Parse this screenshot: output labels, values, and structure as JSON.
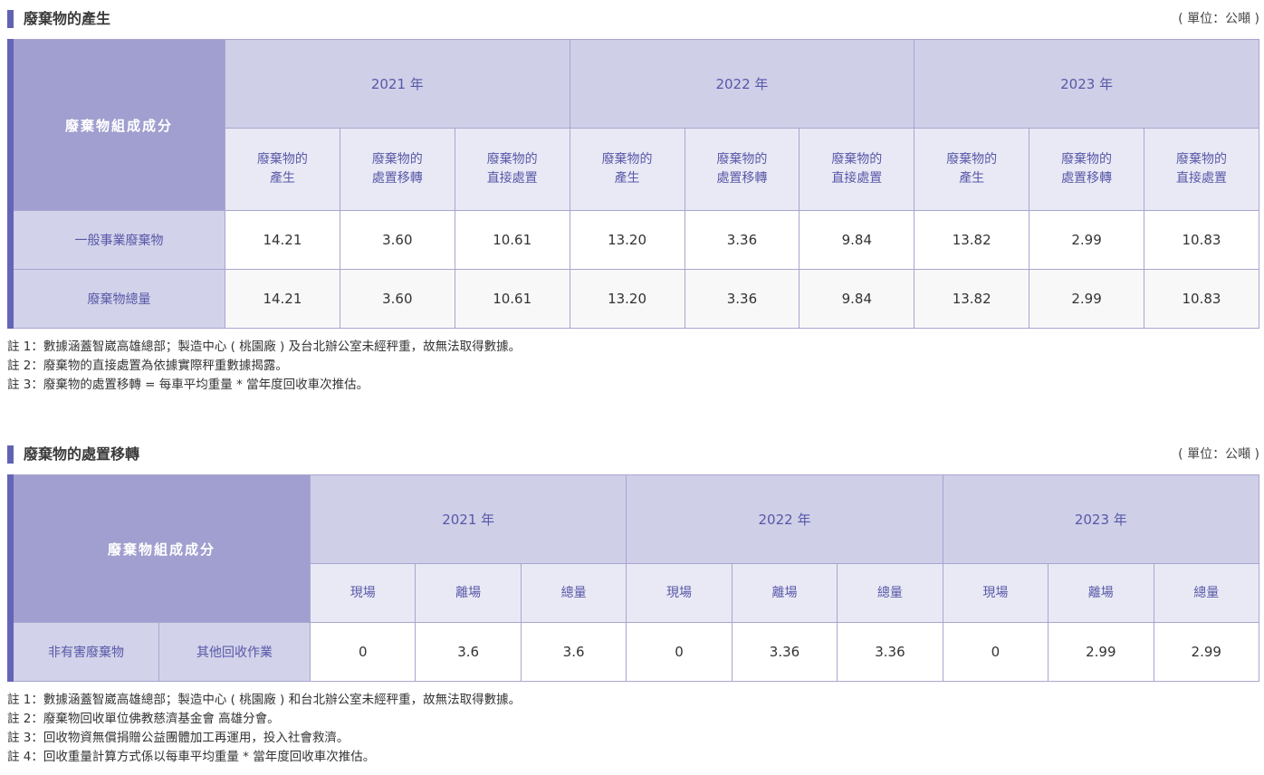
{
  "section1": {
    "title": "廢棄物的產生",
    "unit": "( 單位：公噸 )",
    "corner": "廢棄物組成成分",
    "years": [
      "2021 年",
      "2022 年",
      "2023 年"
    ],
    "subheaders": [
      [
        "廢棄物的",
        "產生"
      ],
      [
        "廢棄物的",
        "處置移轉"
      ],
      [
        "廢棄物的",
        "直接處置"
      ]
    ],
    "rows": [
      {
        "label": "一般事業廢棄物",
        "values": [
          "14.21",
          "3.60",
          "10.61",
          "13.20",
          "3.36",
          "9.84",
          "13.82",
          "2.99",
          "10.83"
        ]
      },
      {
        "label": "廢棄物總量",
        "values": [
          "14.21",
          "3.60",
          "10.61",
          "13.20",
          "3.36",
          "9.84",
          "13.82",
          "2.99",
          "10.83"
        ]
      }
    ],
    "notes": [
      "註 1：數據涵蓋智崴高雄總部；製造中心 ( 桃園廠 ) 及台北辦公室未經秤重，故無法取得數據。",
      "註 2：廢棄物的直接處置為依據實際秤重數據揭露。",
      "註 3：廢棄物的處置移轉 = 每車平均重量 * 當年度回收車次推估。"
    ]
  },
  "section2": {
    "title": "廢棄物的處置移轉",
    "unit": "( 單位：公噸 )",
    "corner": "廢棄物組成成分",
    "years": [
      "2021 年",
      "2022 年",
      "2023 年"
    ],
    "subheaders": [
      "現場",
      "離場",
      "總量"
    ],
    "row": {
      "category": "非有害廢棄物",
      "type": "其他回收作業",
      "values": [
        "0",
        "3.6",
        "3.6",
        "0",
        "3.36",
        "3.36",
        "0",
        "2.99",
        "2.99"
      ]
    },
    "notes": [
      "註 1：數據涵蓋智崴高雄總部；製造中心 ( 桃園廠 ) 和台北辦公室未經秤重，故無法取得數據。",
      "註 2：廢棄物回收單位佛教慈濟基金會 高雄分會。",
      "註 3：回收物資無償捐贈公益團體加工再運用，投入社會救濟。",
      "註 4：回收重量計算方式係以每車平均重量 * 當年度回收車次推估。"
    ]
  }
}
